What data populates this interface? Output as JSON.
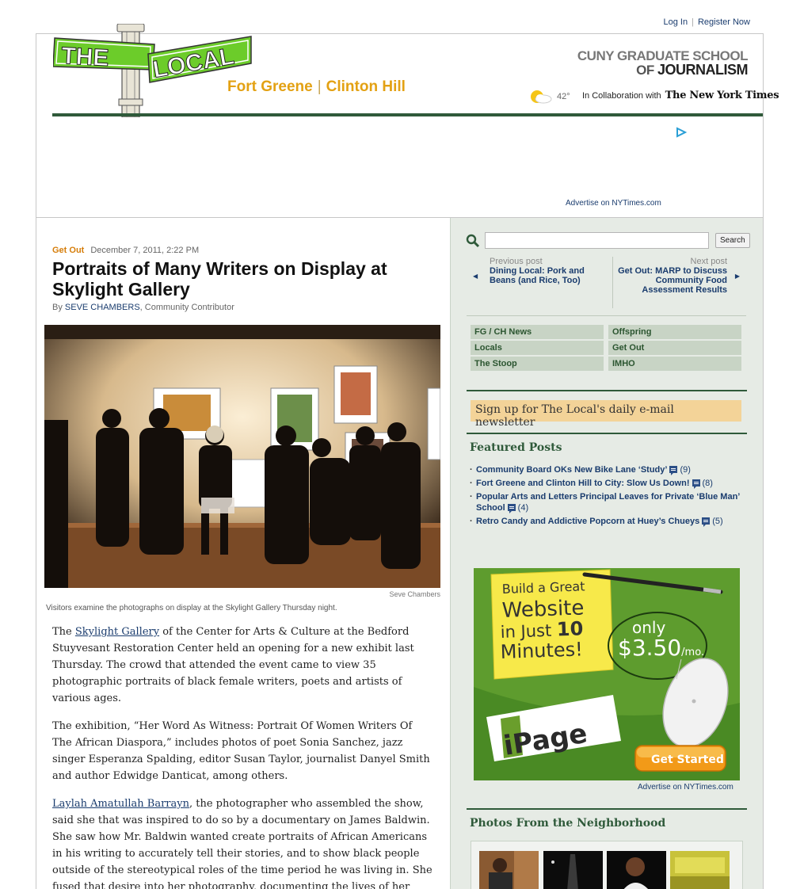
{
  "user_links": {
    "login": "Log In",
    "register": "Register Now"
  },
  "logo": {
    "word_left": "THE",
    "word_right": "LOCAL"
  },
  "location": {
    "left": "Fort Greene",
    "right": "Clinton Hill"
  },
  "cuny": {
    "line1": "CUNY GRADUATE SCHOOL",
    "line2_prefix": "OF ",
    "line2_bold": "JOURNALISM"
  },
  "weather": {
    "temp": "42°"
  },
  "collab": {
    "text": "In Collaboration with",
    "partner": "The New York Times"
  },
  "ads": {
    "advertise_top": "Advertise on NYTimes.com",
    "advertise_side": "Advertise on NYTimes.com"
  },
  "article": {
    "category": "Get Out",
    "date": "December 7, 2011, 2:22 PM",
    "title": "Portraits of Many Writers on Display at Skylight Gallery",
    "by_prefix": "By ",
    "author": "SEVE CHAMBERS",
    "author_role": ", Community Contributor",
    "photo_credit": "Seve Chambers",
    "caption": "Visitors examine the photographs on display at the Skylight Gallery Thursday night.",
    "p1_before": "The ",
    "p1_link": "Skylight Gallery",
    "p1_after": " of the Center for Arts & Culture at the Bedford Stuyvesant Restoration Center held an opening for a new exhibit last Thursday. The crowd that attended the event came to view 35 photographic portraits of black female writers, poets and artists of various ages.",
    "p2": "The exhibition, “Her Word As Witness: Portrait Of Women Writers Of The African Diaspora,” includes photos of poet Sonia Sanchez, jazz singer Esperanza Spalding, editor Susan Taylor, journalist Danyel Smith and author Edwidge Danticat, among others.",
    "p3_link": "Laylah Amatullah Barrayn",
    "p3_after": ", the photographer who assembled the show, said she that was inspired to do so by a documentary on James Baldwin. She saw how Mr. Baldwin wanted create portraits of African Americans in his writing to accurately tell their stories, and to show black people outside of the stereotypical roles of the time period he was living in. She fused that desire into her photography, documenting the lives of her peers and icons."
  },
  "sidebar": {
    "search_button": "Search",
    "prev_label": "Previous post",
    "prev_title": "Dining Local: Pork and Beans (and Rice, Too)",
    "next_label": "Next post",
    "next_title": "Get Out: MARP to Discuss Community Food Assessment Results",
    "categories": [
      "FG / CH News",
      "Offspring",
      "Locals",
      "Get Out",
      "The Stoop",
      "IMHO"
    ],
    "signup": "Sign up for The Local's daily e-mail newsletter",
    "featured_title": "Featured Posts",
    "featured": [
      {
        "title": "Community Board OKs New Bike Lane ‘Study’",
        "count": "(9)"
      },
      {
        "title": "Fort Greene and Clinton Hill to City: Slow Us Down!",
        "count": "(8)"
      },
      {
        "title": "Popular Arts and Letters Principal Leaves for Private ‘Blue Man’ School",
        "count": "(4)"
      },
      {
        "title": "Retro Candy and Addictive Popcorn at Huey’s Chueys",
        "count": "(5)"
      }
    ],
    "photos_title": "Photos From the Neighborhood"
  },
  "banner": {
    "note_l1": "Build a Great",
    "note_l2": "Website",
    "note_l3_prefix": "in Just ",
    "note_l3_num": "10",
    "note_l4": "Minutes!",
    "price_l1": "only",
    "price_l2": "$3.50",
    "price_unit": "/mo.",
    "brand": "iPage",
    "cta": "Get Started"
  }
}
